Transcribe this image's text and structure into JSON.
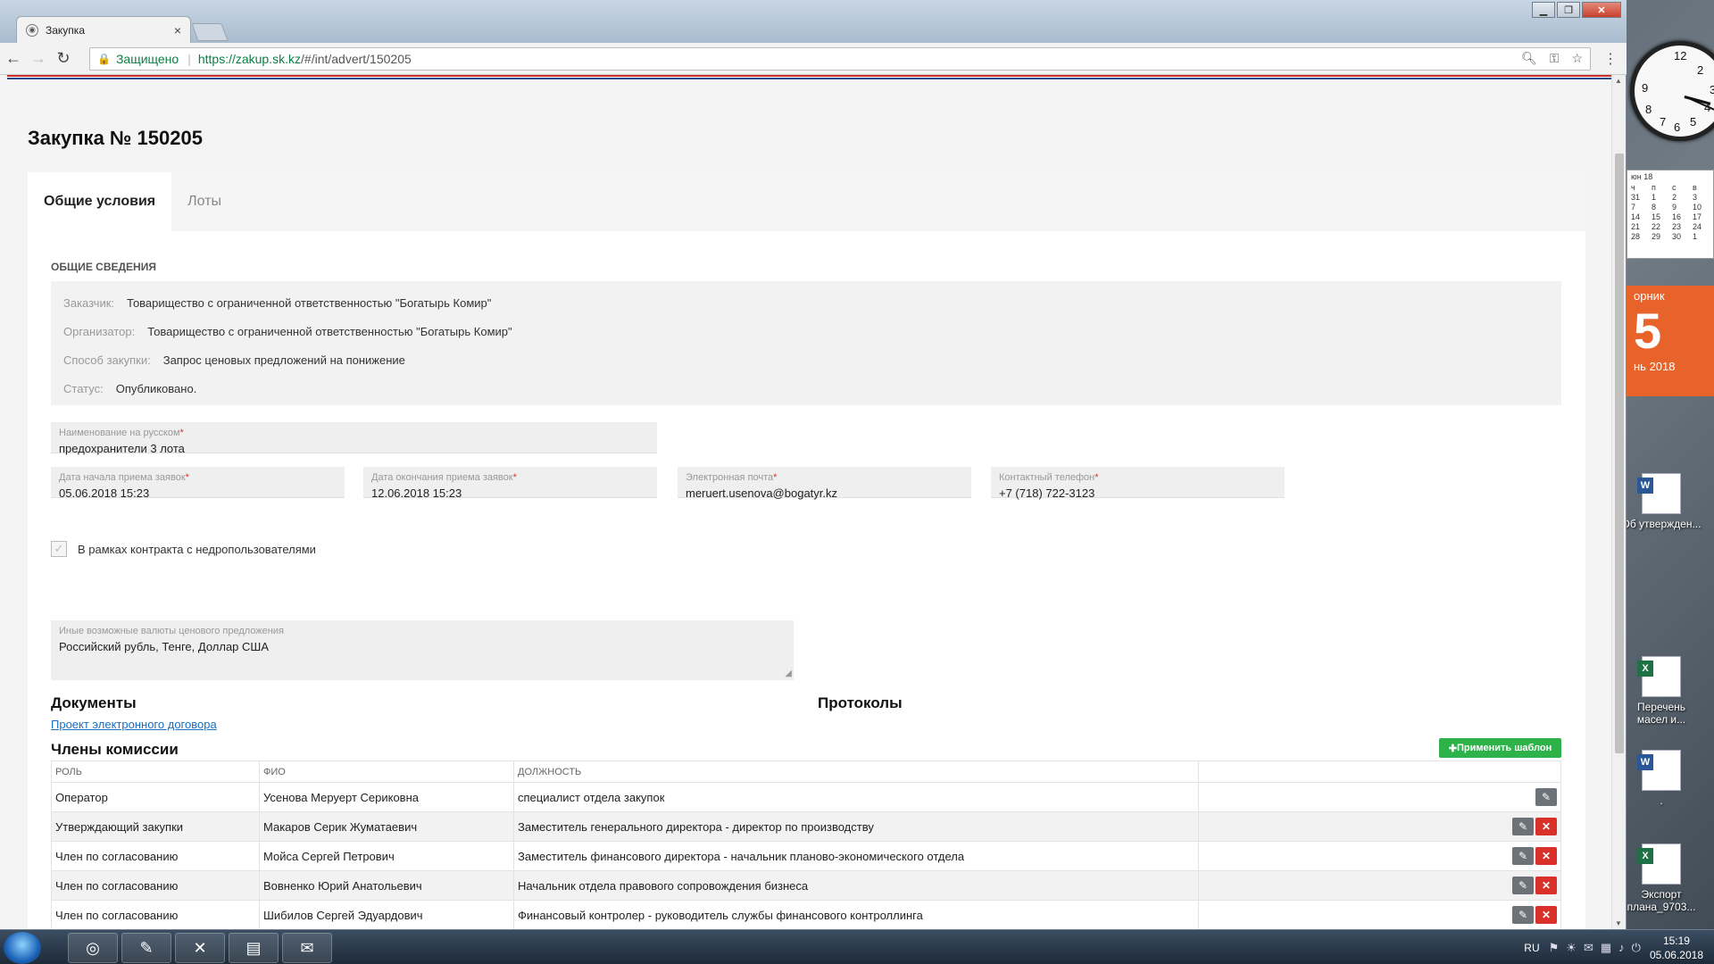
{
  "browser": {
    "tab_title": "Закупка",
    "tab_close": "×",
    "secure_label": "Защищено",
    "url_host": "https://zakup.sk.kz",
    "url_rest": "/#/int/advert/150205"
  },
  "page": {
    "title": "Закупка № 150205",
    "tabs": [
      {
        "label": "Общие условия",
        "active": true
      },
      {
        "label": "Лоты",
        "active": false
      }
    ]
  },
  "general": {
    "section_label": "ОБЩИЕ СВЕДЕНИЯ",
    "rows": [
      {
        "key": "Заказчик:",
        "value": "Товарищество с ограниченной ответственностью \"Богатырь Комир\""
      },
      {
        "key": "Организатор:",
        "value": "Товарищество с ограниченной ответственностью \"Богатырь Комир\""
      },
      {
        "key": "Способ закупки:",
        "value": "Запрос ценовых предложений на понижение"
      },
      {
        "key": "Статус:",
        "value": "Опубликовано."
      }
    ]
  },
  "fields": {
    "name_ru": {
      "label": "Наименование на русском",
      "value": "предохранители 3 лота"
    },
    "start_date": {
      "label": "Дата начала приема заявок",
      "value": "05.06.2018 15:23"
    },
    "end_date": {
      "label": "Дата окончания приема заявок",
      "value": "12.06.2018 15:23"
    },
    "email": {
      "label": "Электронная почта",
      "value": "meruert.usenova@bogatyr.kz"
    },
    "phone": {
      "label": "Контактный телефон",
      "value": "+7 (718) 722-3123"
    },
    "subsoil_checkbox": {
      "label": "В рамках контракта с недропользователями",
      "checked": false
    },
    "currencies": {
      "label": "Иные возможные валюты ценового предложения",
      "value": "Российский  рубль, Тенге, Доллар США"
    },
    "required_mark": "*"
  },
  "documents": {
    "heading": "Документы",
    "links": [
      "Проект электронного договора"
    ]
  },
  "protocols": {
    "heading": "Протоколы"
  },
  "commission": {
    "heading": "Члены комиссии",
    "apply_template_label": "Применить шаблон",
    "columns": [
      "РОЛЬ",
      "ФИО",
      "ДОЛЖНОСТЬ",
      ""
    ],
    "rows": [
      {
        "role": "Оператор",
        "name": "Усенова Меруерт Сериковна",
        "position": "специалист отдела закупок",
        "deletable": false
      },
      {
        "role": "Утверждающий закупки",
        "name": "Макаров Серик Жуматаевич",
        "position": "Заместитель генерального директора - директор по производству",
        "deletable": true
      },
      {
        "role": "Член по согласованию",
        "name": "Мойса Сергей Петрович",
        "position": "Заместитель финансового директора - начальник планово-экономического отдела",
        "deletable": true
      },
      {
        "role": "Член по согласованию",
        "name": "Вовненко Юрий Анатольевич",
        "position": "Начальник отдела правового сопровождения бизнеса",
        "deletable": true
      },
      {
        "role": "Член по согласованию",
        "name": "Шибилов Сергей Эдуардович",
        "position": "Финансовый контролер - руководитель службы финансового контроллинга",
        "deletable": true
      }
    ]
  },
  "desktop": {
    "calendar_header": "юн 18",
    "calendar_days": [
      "ч",
      "п",
      "с",
      "в",
      "31",
      "1",
      "2",
      "3",
      "7",
      "8",
      "9",
      "10",
      "14",
      "15",
      "16",
      "17",
      "21",
      "22",
      "23",
      "24",
      "28",
      "29",
      "30",
      "1"
    ],
    "date_gadget": {
      "weekday": "орник",
      "day": "5",
      "month": "нь 2018"
    },
    "icons": [
      {
        "label": "Об утвержден...",
        "type": "doc"
      },
      {
        "label": "Перечень масел и...",
        "type": "xls"
      },
      {
        "label": ".",
        "type": "doc"
      },
      {
        "label": "Экспорт плана_9703...",
        "type": "xls"
      }
    ]
  },
  "taskbar": {
    "lang": "RU",
    "time": "15:19",
    "date": "05.06.2018"
  }
}
